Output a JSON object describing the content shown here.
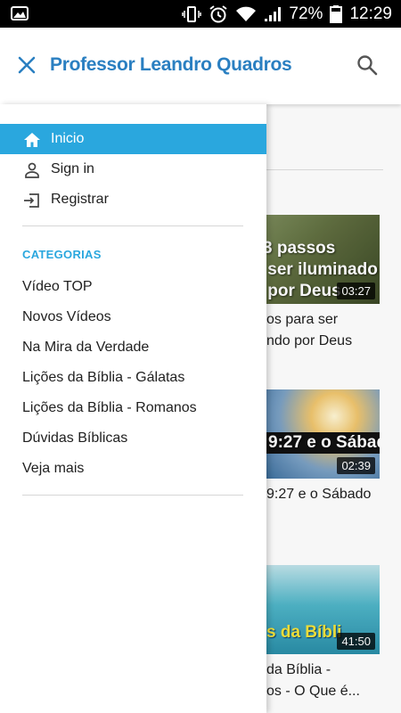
{
  "status_bar": {
    "battery": "72%",
    "time": "12:29"
  },
  "app_bar": {
    "title": "Professor Leandro Quadros"
  },
  "drawer": {
    "items": [
      {
        "label": "Inicio",
        "icon": "home-icon",
        "active": true
      },
      {
        "label": "Sign in",
        "icon": "person-icon",
        "active": false
      },
      {
        "label": "Registrar",
        "icon": "login-icon",
        "active": false
      }
    ],
    "categories_header": "CATEGORIAS",
    "categories": [
      "Vídeo TOP",
      "Novos Vídeos",
      "Na Mira da Verdade",
      "Lições da Bíblia - Gálatas",
      "Lições da Bíblia - Romanos",
      "Dúvidas Bíblicas",
      "Veja mais"
    ]
  },
  "videos": [
    {
      "thumb_text": "3 passos\n ser iluminado\n por Deus",
      "duration": "03:27",
      "title_line1": "os para ser",
      "title_line2": "ndo por Deus"
    },
    {
      "thumb_text": "9:27 e o Sábado",
      "duration": "02:39",
      "title_line1": "9:27 e o Sábado",
      "title_line2": ""
    },
    {
      "thumb_text": "s da Bíbli",
      "duration": "41:50",
      "title_line1": " da Bíblia -",
      "title_line2": "os - O Que é..."
    }
  ],
  "colors": {
    "accent": "#2aa7de",
    "title": "#2a7fc1"
  }
}
